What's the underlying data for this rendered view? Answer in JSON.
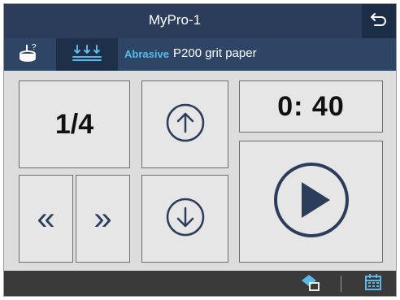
{
  "title": "MyPro-1",
  "icons": {
    "back": "back-arrow-icon",
    "cup": "cup-help-icon",
    "levels": "level-arrows-icon",
    "up": "arrow-up-circle-icon",
    "down": "arrow-down-circle-icon",
    "play": "play-circle-icon",
    "export": "export-icon",
    "calendar": "calendar-icon"
  },
  "toolbar": {
    "abrasive_label": "Abrasive",
    "abrasive_value": "P200 grit paper"
  },
  "controls": {
    "step": "1/4",
    "timer": "0: 40",
    "prev": "«",
    "next": "»"
  },
  "colors": {
    "header": "#2b3d5a",
    "toolbar": "#2e4566",
    "accent": "#5ab9e8",
    "footer": "#3a3a3a",
    "panel": "#dddddd",
    "button": "#e6e6e6"
  }
}
